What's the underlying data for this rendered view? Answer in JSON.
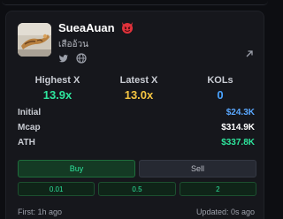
{
  "token": {
    "name": "SueaAuan",
    "subtitle": "เสืออ้วน",
    "badge_icon": "devil-emoji-icon"
  },
  "socials": [
    "twitter-icon",
    "globe-icon"
  ],
  "stats": [
    {
      "label": "Highest X",
      "value": "13.9x"
    },
    {
      "label": "Latest X",
      "value": "13.0x"
    },
    {
      "label": "KOLs",
      "value": "0"
    }
  ],
  "metrics": [
    {
      "label": "Initial",
      "value": "$24.3K"
    },
    {
      "label": "Mcap",
      "value": "$314.9K"
    },
    {
      "label": "ATH",
      "value": "$337.8K"
    }
  ],
  "actions": {
    "buy": "Buy",
    "sell": "Sell"
  },
  "amounts": [
    "0.01",
    "0.5",
    "2"
  ],
  "footer": {
    "first": "First: 1h ago",
    "updated": "Updated: 0s ago"
  },
  "colors": {
    "green": "#2ee59d",
    "yellow": "#f5c542",
    "blue": "#4aa3ff",
    "background": "#16171c"
  }
}
